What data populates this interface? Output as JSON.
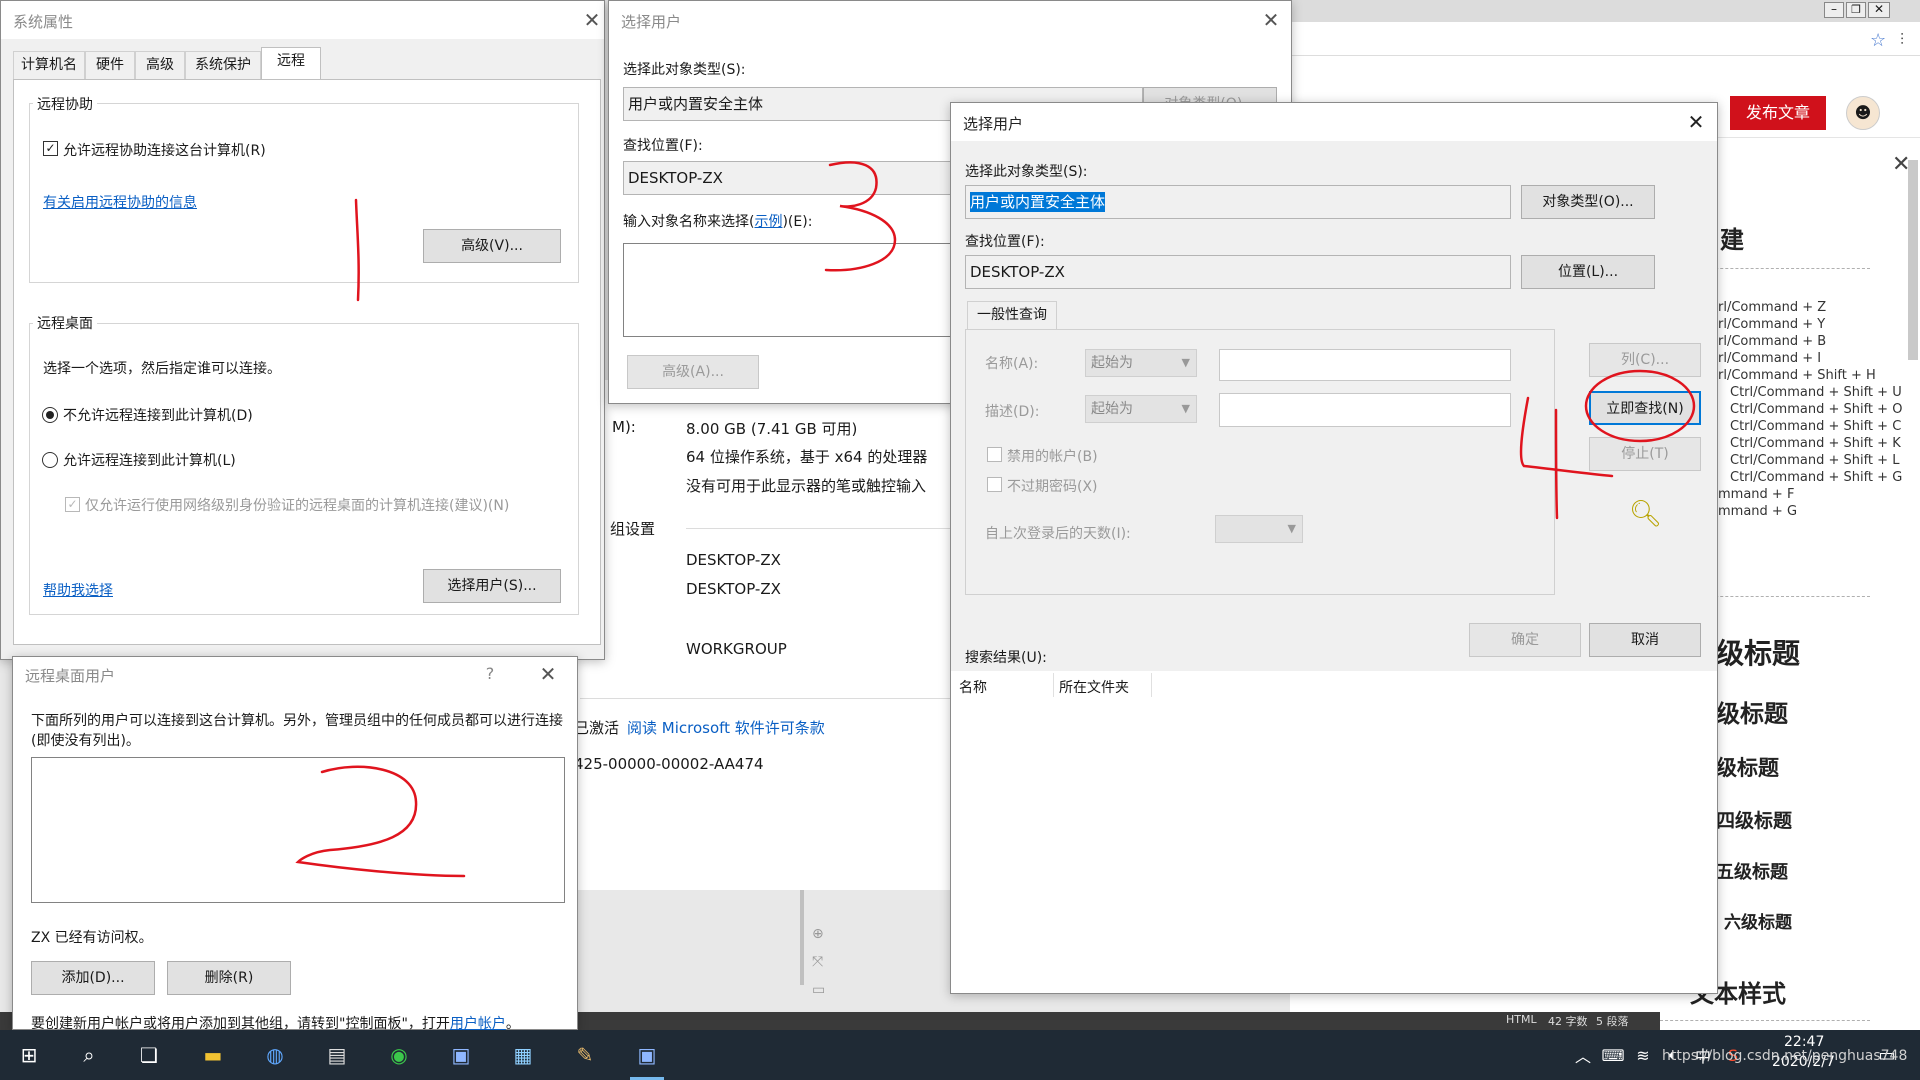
{
  "colors": {
    "accent_red": "#d0111b",
    "link": "#0a5fc4",
    "annotation": "#e0141e",
    "selection": "#0078d7",
    "taskbar": "#1f2a35"
  },
  "browser": {
    "publish_label": "发布文章",
    "menu_labels": [
      "建",
      "级标题",
      "级标题",
      "级标题",
      "四级标题",
      "五级标题",
      "六级标题",
      "文本样式"
    ],
    "shortcuts": [
      "rl/Command + Z",
      "rl/Command + Y",
      "rl/Command + B",
      "rl/Command + I",
      "rl/Command + Shift + H",
      "Ctrl/Command + Shift + U",
      "Ctrl/Command + Shift + O",
      "Ctrl/Command + Shift + C",
      "Ctrl/Command + Shift + K",
      "Ctrl/Command + Shift + L",
      "Ctrl/Command + Shift + G",
      "mmand + F",
      "mmand + G"
    ],
    "status_html": "HTML",
    "status_words": "42 字数",
    "status_paras": "5 段落"
  },
  "sysinfo": {
    "ram_label": "M):",
    "ram_value": "8.00 GB (7.41 GB 可用)",
    "system_type": "64 位操作系统，基于 x64 的处理器",
    "pen": "没有可用于此显示器的笔或触控输入",
    "section": "组设置",
    "computer_name": "DESKTOP-ZX",
    "full_name": "DESKTOP-ZX",
    "workgroup": "WORKGROUP",
    "activation": "已激活",
    "license_link": "阅读 Microsoft 软件许可条款",
    "product_id": "425-00000-00002-AA474"
  },
  "sysprops": {
    "title": "系统属性",
    "tabs": [
      "计算机名",
      "硬件",
      "高级",
      "系统保护",
      "远程"
    ],
    "remote_assist_group": "远程协助",
    "allow_assist": "允许远程协助连接这台计算机(R)",
    "assist_info_link": "有关启用远程协助的信息",
    "advanced_btn": "高级(V)...",
    "remote_desktop_group": "远程桌面",
    "choose_option": "选择一个选项，然后指定谁可以连接。",
    "deny_option": "不允许远程连接到此计算机(D)",
    "allow_option": "允许远程连接到此计算机(L)",
    "nla_option": "仅允许运行使用网络级别身份验证的远程桌面的计算机连接(建议)(N)",
    "help_link": "帮助我选择",
    "select_users_btn": "选择用户(S)..."
  },
  "rdusers": {
    "title": "远程桌面用户",
    "help_glyph": "?",
    "description": "下面所列的用户可以连接到这台计算机。另外，管理员组中的任何成员都可以进行连接(即使没有列出)。",
    "access_note": "ZX 已经有访问权。",
    "add_btn": "添加(D)...",
    "remove_btn": "删除(R)",
    "footer_text": "要创建新用户帐户或将用户添加到其他组，请转到\"控制面板\"，打开",
    "footer_link": "用户帐户",
    "footer_end": "。"
  },
  "selectUsers1": {
    "title": "选择用户",
    "object_type_label": "选择此对象类型(S):",
    "object_type_value": "用户或内置安全主体",
    "object_type_btn": "对象类型(O)...",
    "location_label": "查找位置(F):",
    "location_value": "DESKTOP-ZX",
    "enter_names_label": "输入对象名称来选择(",
    "example_link": "示例",
    "enter_names_end": ")(E):",
    "advanced_btn": "高级(A)..."
  },
  "selectUsers2": {
    "title": "选择用户",
    "object_type_label": "选择此对象类型(S):",
    "object_type_value": "用户或内置安全主体",
    "object_type_btn": "对象类型(O)...",
    "location_label": "查找位置(F):",
    "location_value": "DESKTOP-ZX",
    "location_btn": "位置(L)...",
    "common_queries_tab": "一般性查询",
    "name_label": "名称(A):",
    "name_combo": "起始为",
    "desc_label": "描述(D):",
    "desc_combo": "起始为",
    "disabled_accounts": "禁用的帐户(B)",
    "non_expiring": "不过期密码(X)",
    "days_label": "自上次登录后的天数(I):",
    "columns_btn": "列(C)...",
    "find_now_btn": "立即查找(N)",
    "stop_btn": "停止(T)",
    "ok_btn": "确定",
    "cancel_btn": "取消",
    "results_label": "搜索结果(U):",
    "col_name": "名称",
    "col_folder": "所在文件夹"
  },
  "annotations": [
    "1",
    "2",
    "3",
    "4"
  ],
  "tray": {
    "time": "22:47",
    "date": "2020/2/7",
    "watermark": "https://blog.csdn.net/penghuas748"
  }
}
